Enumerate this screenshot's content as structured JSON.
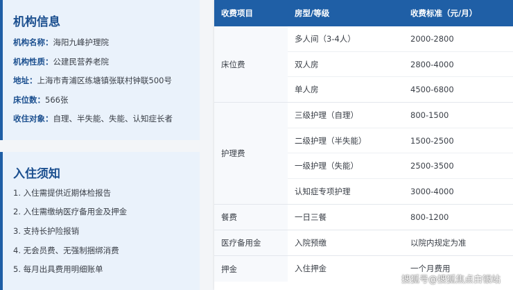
{
  "info": {
    "title": "机构信息",
    "rows": [
      {
        "key": "机构名称：",
        "value": "海阳九峰护理院"
      },
      {
        "key": "机构性质：",
        "value": "公建民营养老院"
      },
      {
        "key": "地址：",
        "value": "上海市青浦区练塘镇张联村钟联500号"
      },
      {
        "key": "床位数：",
        "value": "566张"
      },
      {
        "key": "收住对象：",
        "value": "自理、半失能、失能、认知症长者"
      }
    ]
  },
  "notice": {
    "title": "入住须知",
    "items": [
      "1. 入住需提供近期体检报告",
      "2. 入住需缴纳医疗备用金及押金",
      "3. 支持长护险报销",
      "4. 无会员费、无强制捆绑消费",
      "5. 每月出具费用明细账单"
    ]
  },
  "table": {
    "headers": {
      "category": "收费项目",
      "type": "房型/等级",
      "price": "收费标准（元/月）"
    },
    "groups": [
      {
        "category": "床位费",
        "rows": [
          {
            "type": "多人间（3-4人）",
            "price": "2000-2800"
          },
          {
            "type": "双人房",
            "price": "2800-4000"
          },
          {
            "type": "单人房",
            "price": "4500-6800"
          }
        ]
      },
      {
        "category": "护理费",
        "rows": [
          {
            "type": "三级护理（自理）",
            "price": "800-1500"
          },
          {
            "type": "二级护理（半失能）",
            "price": "1500-2500"
          },
          {
            "type": "一级护理（失能）",
            "price": "2500-3500"
          },
          {
            "type": "认知症专项护理",
            "price": "3000-4000"
          }
        ]
      },
      {
        "category": "餐费",
        "rows": [
          {
            "type": "一日三餐",
            "price": "800-1200"
          }
        ]
      },
      {
        "category": "医疗备用金",
        "rows": [
          {
            "type": "入院预缴",
            "price": "以院内规定为准"
          }
        ]
      },
      {
        "category": "押金",
        "rows": [
          {
            "type": "入住押金",
            "price": "一个月费用"
          }
        ]
      }
    ]
  },
  "watermark": "搜狐号@搜狐焦点白银站",
  "colors": {
    "accent": "#1f5fa6",
    "card_bg": "#eaf2fb",
    "text": "#3a3f47"
  }
}
